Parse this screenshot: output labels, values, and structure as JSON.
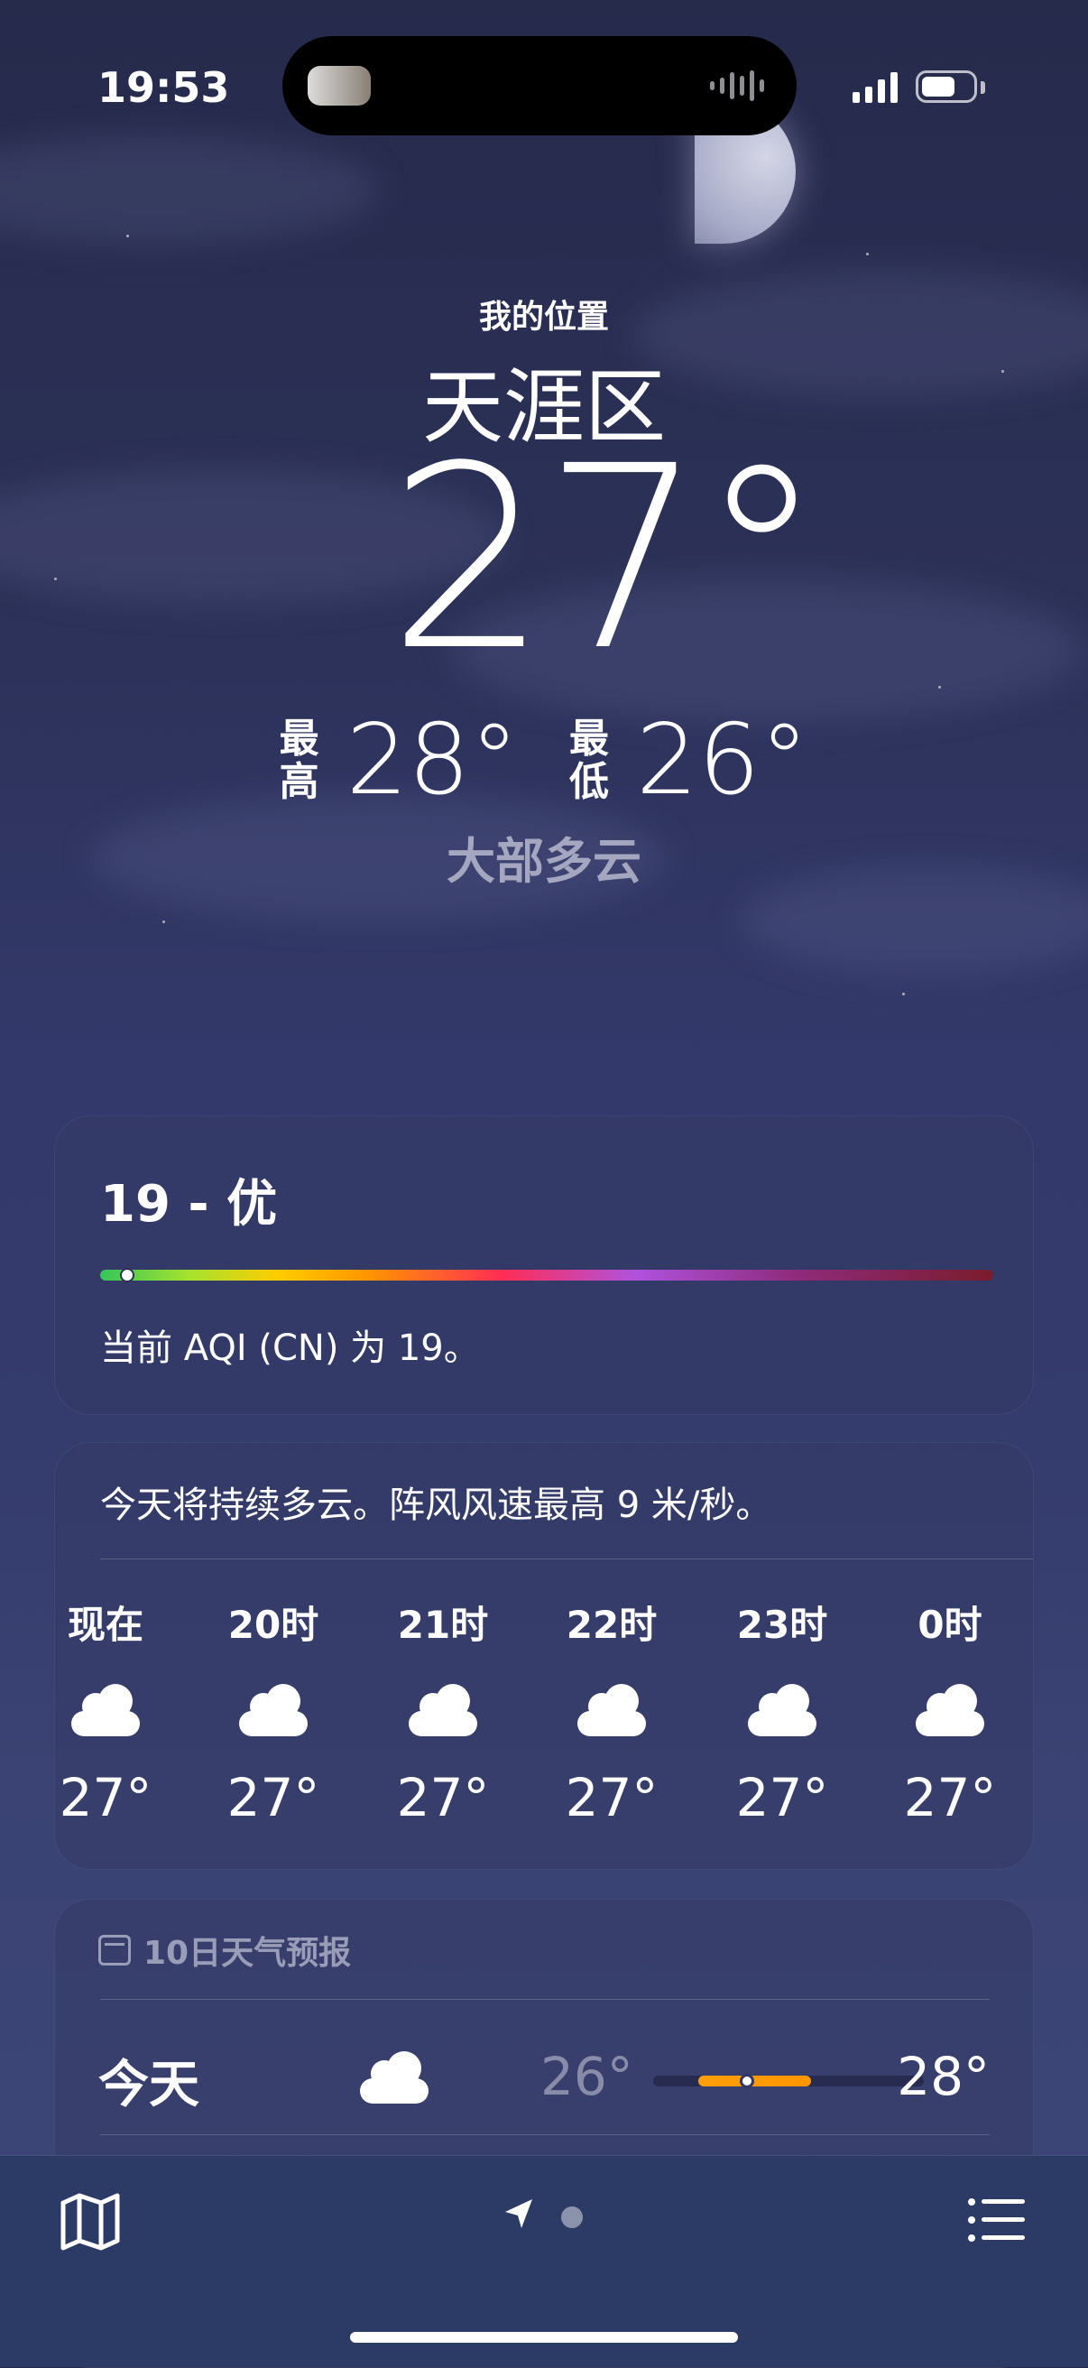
{
  "status_bar": {
    "time": "19:53"
  },
  "header": {
    "location_label": "我的位置",
    "city": "天涯区",
    "temperature": "27°",
    "high_label": "最高",
    "high": "28°",
    "low_label": "最低",
    "low": "26°",
    "condition": "大部多云"
  },
  "aqi": {
    "value_text": "19 - 优",
    "description": "当前 AQI (CN) 为 19。",
    "indicator_fraction": 0.03
  },
  "hourly": {
    "summary": "今天将持续多云。阵风风速最高 9 米/秒。",
    "items": [
      {
        "time": "现在",
        "icon": "cloud-icon",
        "temp": "27°"
      },
      {
        "time": "20时",
        "icon": "cloud-icon",
        "temp": "27°"
      },
      {
        "time": "21时",
        "icon": "cloud-icon",
        "temp": "27°"
      },
      {
        "time": "22时",
        "icon": "cloud-icon",
        "temp": "27°"
      },
      {
        "time": "23时",
        "icon": "cloud-icon",
        "temp": "27°"
      },
      {
        "time": "0时",
        "icon": "cloud-icon",
        "temp": "27°"
      }
    ]
  },
  "forecast": {
    "title": "10日天气预报",
    "rows": [
      {
        "day": "今天",
        "icon": "cloud-icon",
        "low": "26°",
        "high": "28°"
      }
    ]
  },
  "tab_bar": {
    "icons": [
      "map-icon",
      "location-arrow-icon",
      "page-dot",
      "list-icon"
    ]
  },
  "colors": {
    "accent_orange": "#ff9500",
    "background_top": "#262a4b",
    "tab_bar": "#2c3a66"
  }
}
